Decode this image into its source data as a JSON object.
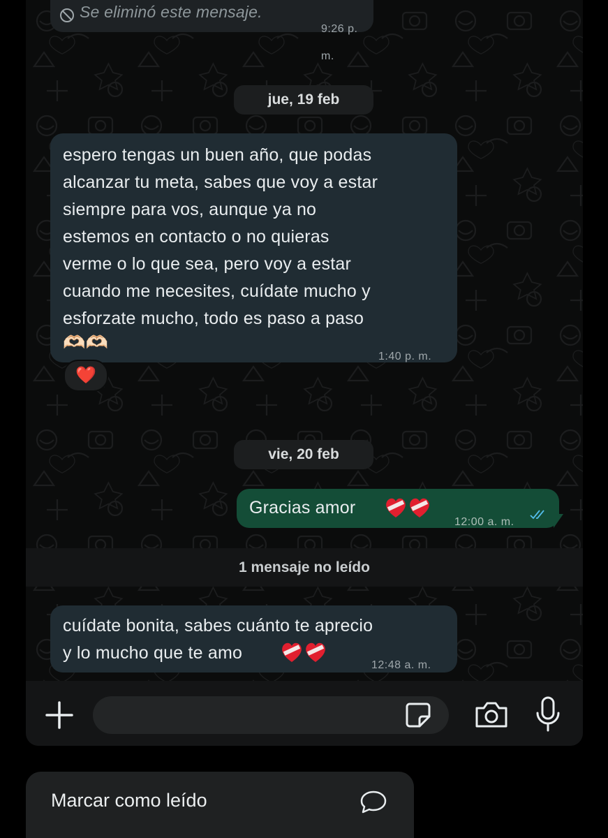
{
  "messages": {
    "deleted": {
      "text": "Se eliminó este mensaje.",
      "time": "9:26 p. m."
    },
    "date_1": "jue, 19 feb",
    "incoming_1": {
      "text": "espero tengas un buen año, que podas\nalcanzar tu meta, sabes que voy a estar\nsiempre para vos, aunque ya no\nestemos en contacto o no quieras\nverme o lo que sea, pero voy a estar\ncuando me necesites, cuídate mucho y\nesforzate mucho, todo es paso a paso",
      "emojis": "🫶🏻🫶🏻",
      "time": "1:40 p. m.",
      "reaction": "❤️"
    },
    "date_2": "vie, 20 feb",
    "outgoing_1": {
      "text": "Gracias amor",
      "time": "12:00 a. m."
    },
    "unread_banner": "1 mensaje no leído",
    "incoming_2": {
      "text": "cuídate bonita, sabes cuánto te aprecio\ny lo mucho que te amo",
      "time": "12:48 a. m."
    }
  },
  "input": {
    "placeholder": ""
  },
  "context_menu": {
    "mark_read_label": "Marcar como leído"
  },
  "colors": {
    "outgoing_bubble": "#144d37",
    "incoming_bubble": "#202c33",
    "read_ticks": "#53bdeb"
  }
}
